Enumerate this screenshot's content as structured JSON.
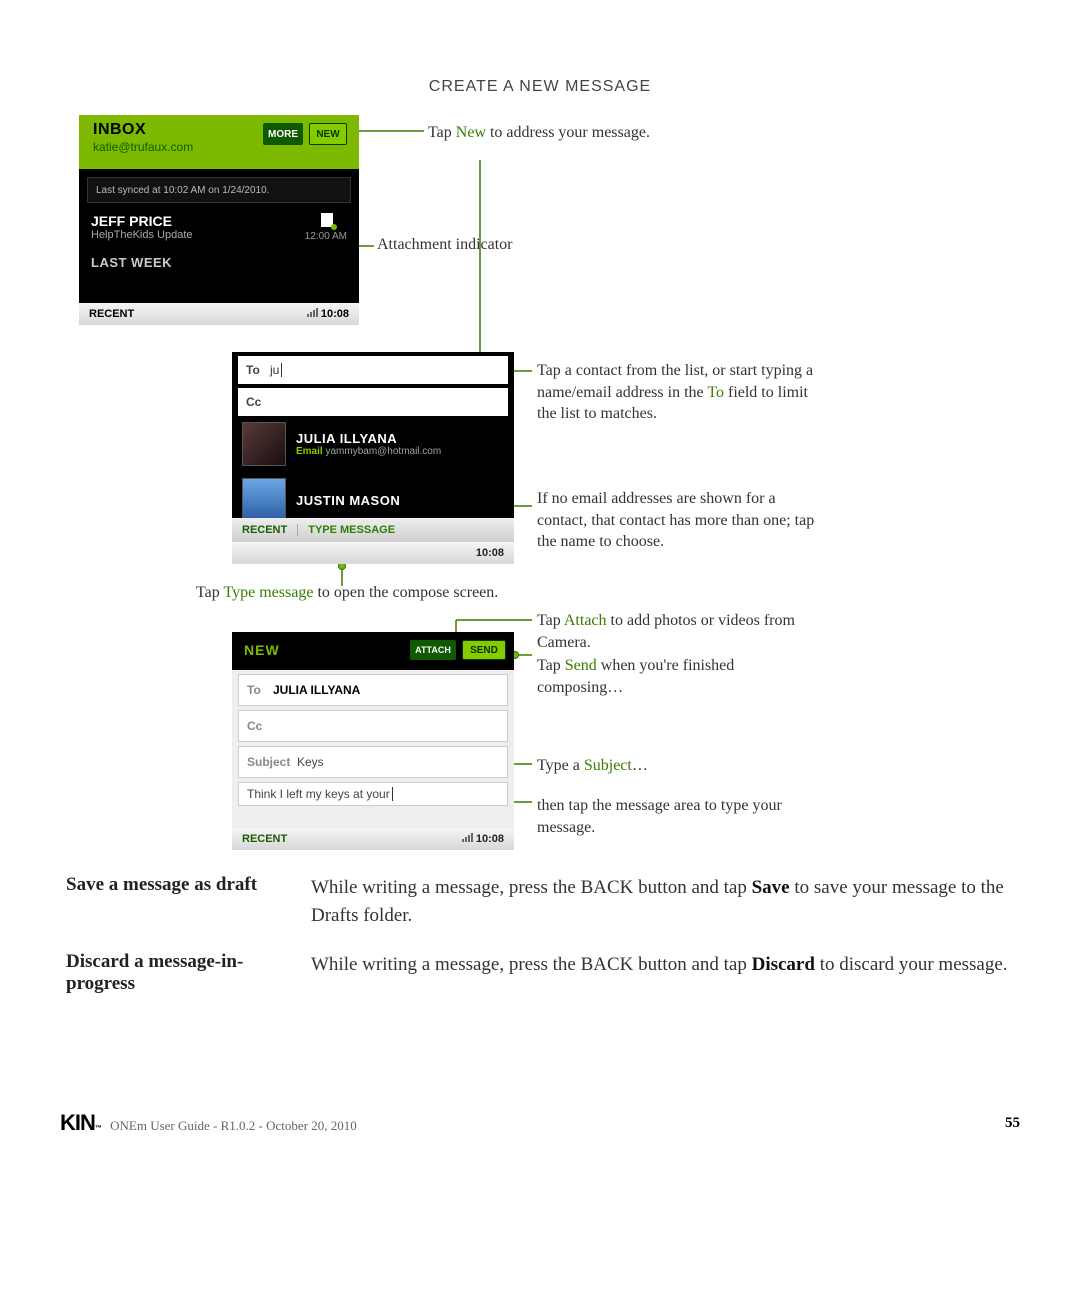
{
  "page_title": "CREATE A NEW MESSAGE",
  "shot1": {
    "title": "INBOX",
    "email": "katie@trufaux.com",
    "more": "MORE",
    "new": "NEW",
    "sync": "Last synced at 10:02 AM on 1/24/2010.",
    "sender": "JEFF PRICE",
    "subject": "HelpTheKids Update",
    "time": "12:00 AM",
    "lastweek": "LAST WEEK",
    "recent": "RECENT",
    "clock": "10:08"
  },
  "shot2": {
    "to_label": "To",
    "to_value": "ju",
    "cc_label": "Cc",
    "julia": "JULIA ILLYANA",
    "julia_email_label": "Email",
    "julia_email": "yammybam@hotmail.com",
    "justin": "JUSTIN MASON",
    "recent": "RECENT",
    "type_message": "TYPE MESSAGE",
    "clock": "10:08"
  },
  "shot3": {
    "new": "NEW",
    "attach": "ATTACH",
    "send": "SEND",
    "to_label": "To",
    "to_value": "JULIA ILLYANA",
    "cc_label": "Cc",
    "subject_label": "Subject",
    "subject_value": "Keys",
    "body": "Think I left my keys at your",
    "recent": "RECENT",
    "clock": "10:08"
  },
  "callouts": {
    "c1_a": "Tap ",
    "c1_kw": "New",
    "c1_b": " to address your message.",
    "c2": "Attachment indicator",
    "c3_a": "Tap a contact from the list, or start typing a name/email address in the ",
    "c3_kw": "To",
    "c3_b": " field to limit the list to matches.",
    "c4": "If no email addresses are shown for a contact, that contact has more than one; tap the name to choose.",
    "c5_a": "Tap ",
    "c5_kw": "Type message",
    "c5_b": " to open the compose screen.",
    "c6_a": "Tap ",
    "c6_kw": "Attach",
    "c6_b": " to add photos or videos from Camera.",
    "c7_a": "Tap ",
    "c7_kw": "Send",
    "c7_b": " when you're finished composing…",
    "c8_a": "Type a ",
    "c8_kw": "Subject",
    "c8_b": "…",
    "c9": "then tap the message area to type your message."
  },
  "instr": {
    "h1": "Save a message as draft",
    "b1_a": "While writing a message, press the BACK button and tap ",
    "b1_bold": "Save",
    "b1_b": " to save your message to the Drafts folder.",
    "h2": "Discard a message-in-progress",
    "b2_a": "While writing a message, press the BACK button and tap ",
    "b2_bold": "Discard",
    "b2_b": " to discard your message."
  },
  "footer": {
    "text": " ONEm User Guide - R1.0.2 - October 20, 2010",
    "page": "55"
  }
}
